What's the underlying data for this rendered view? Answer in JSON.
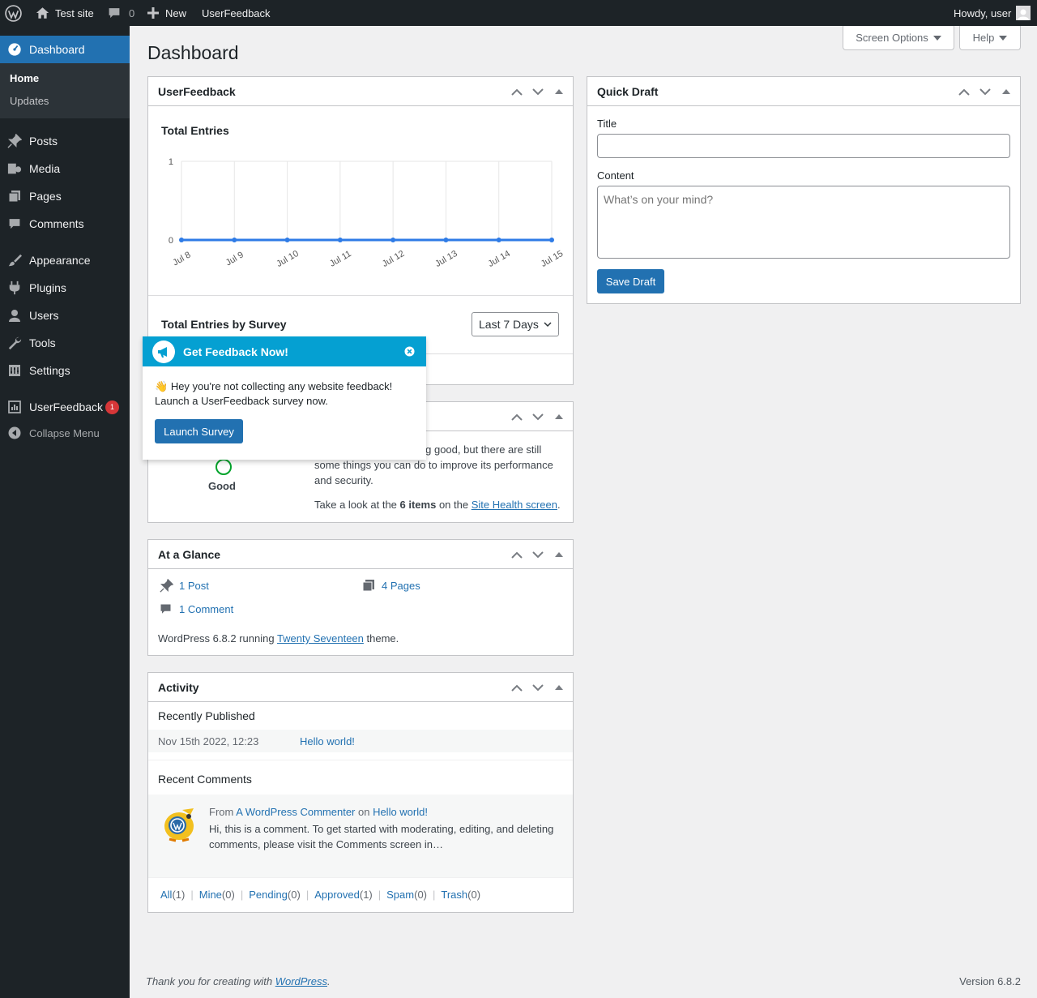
{
  "adminbar": {
    "site_name": "Test site",
    "comments_count": "0",
    "new_label": "New",
    "plugin_label": "UserFeedback",
    "howdy": "Howdy, user"
  },
  "sidebar": {
    "dashboard": "Dashboard",
    "home": "Home",
    "updates": "Updates",
    "items": [
      {
        "label": "Posts",
        "icon": "pin-icon"
      },
      {
        "label": "Media",
        "icon": "media-icon"
      },
      {
        "label": "Pages",
        "icon": "pages-icon"
      },
      {
        "label": "Comments",
        "icon": "comment-icon"
      },
      {
        "label": "Appearance",
        "icon": "brush-icon"
      },
      {
        "label": "Plugins",
        "icon": "plug-icon"
      },
      {
        "label": "Users",
        "icon": "user-icon"
      },
      {
        "label": "Tools",
        "icon": "wrench-icon"
      },
      {
        "label": "Settings",
        "icon": "settings-icon"
      }
    ],
    "userfeedback": "UserFeedback",
    "userfeedback_badge": "1",
    "collapse": "Collapse Menu"
  },
  "screen_options": "Screen Options",
  "help": "Help",
  "page_title": "Dashboard",
  "userfeedback_widget": {
    "title": "UserFeedback",
    "chart_title": "Total Entries",
    "by_survey_title": "Total Entries by Survey",
    "range_select": "Last 7 Days"
  },
  "chart_data": {
    "type": "line",
    "title": "Total Entries",
    "x": [
      "Jul 8",
      "Jul 9",
      "Jul 10",
      "Jul 11",
      "Jul 12",
      "Jul 13",
      "Jul 14",
      "Jul 15"
    ],
    "series": [
      {
        "values": [
          0,
          0,
          0,
          0,
          0,
          0,
          0,
          0
        ],
        "color": "#2e7be6"
      }
    ],
    "ylim": [
      0,
      1
    ],
    "yticks": [
      "0",
      "1"
    ],
    "grid": true
  },
  "popup": {
    "title": "Get Feedback Now!",
    "emoji": "👋",
    "line1": "Hey you're not collecting any website feedback!",
    "line2": "Launch a UserFeedback survey now.",
    "button": "Launch Survey"
  },
  "site_health": {
    "status": "Good",
    "text_visible": "ing good, but there are still",
    "line2": "some things you can do to improve its performance",
    "line3": "and security.",
    "look_prefix": "Take a look at the ",
    "items": "6 items",
    "look_mid": " on the ",
    "link": "Site Health screen",
    "look_suffix": "."
  },
  "glance": {
    "title": "At a Glance",
    "posts": "1 Post",
    "pages": "4 Pages",
    "comments": "1 Comment",
    "wp_prefix": "WordPress 6.8.2 running ",
    "theme": "Twenty Seventeen",
    "wp_suffix": " theme."
  },
  "activity": {
    "title": "Activity",
    "recently_published": "Recently Published",
    "pub_date": "Nov 15th 2022, 12:23",
    "pub_title": "Hello world!",
    "recent_comments": "Recent Comments",
    "from": "From ",
    "commenter": "A WordPress Commenter",
    "on": " on ",
    "comment_post": "Hello world!",
    "comment_line1": "Hi, this is a comment. To get started with moderating, editing, and deleting",
    "comment_line2": "comments, please visit the Comments screen in…",
    "filters": [
      {
        "label": "All",
        "count": "(1)"
      },
      {
        "label": "Mine",
        "count": "(0)"
      },
      {
        "label": "Pending",
        "count": "(0)"
      },
      {
        "label": "Approved",
        "count": "(1)"
      },
      {
        "label": "Spam",
        "count": "(0)"
      },
      {
        "label": "Trash",
        "count": "(0)"
      }
    ]
  },
  "quick_draft": {
    "title": "Quick Draft",
    "title_label": "Title",
    "content_label": "Content",
    "content_placeholder": "What’s on your mind?",
    "save": "Save Draft"
  },
  "footer": {
    "thanks": "Thank you for creating with ",
    "wp_link": "WordPress",
    "period": ".",
    "version": "Version 6.8.2"
  }
}
